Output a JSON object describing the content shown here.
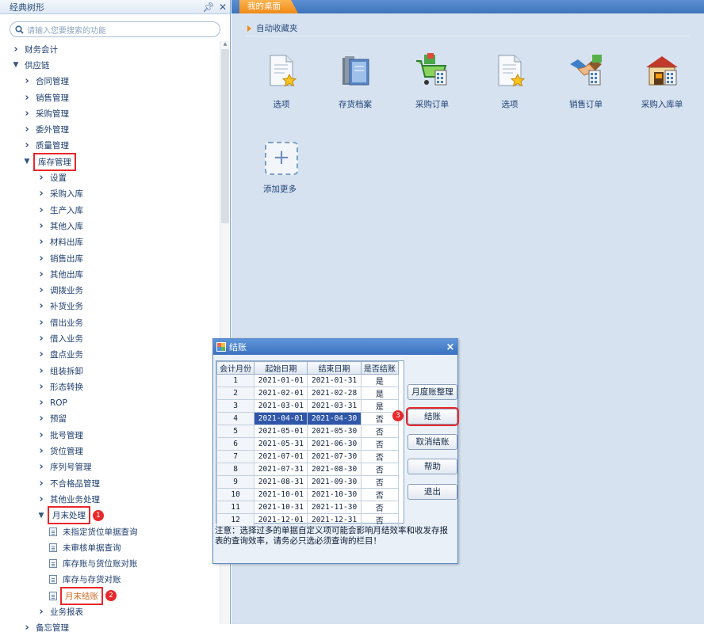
{
  "left_panel": {
    "title": "经典树形",
    "pin_icon": "pin-icon",
    "close_icon": "close-icon",
    "search_placeholder": "请输入您要搜索的功能",
    "tree": [
      {
        "label": "财务会计",
        "level": 0,
        "expanded": false
      },
      {
        "label": "供应链",
        "level": 0,
        "expanded": true
      },
      {
        "label": "合同管理",
        "level": 1,
        "expanded": false
      },
      {
        "label": "销售管理",
        "level": 1,
        "expanded": false
      },
      {
        "label": "采购管理",
        "level": 1,
        "expanded": false
      },
      {
        "label": "委外管理",
        "level": 1,
        "expanded": false
      },
      {
        "label": "质量管理",
        "level": 1,
        "expanded": false
      },
      {
        "label": "库存管理",
        "level": 1,
        "expanded": true,
        "highlight": true
      },
      {
        "label": "设置",
        "level": 2,
        "expanded": false
      },
      {
        "label": "采购入库",
        "level": 2,
        "expanded": false
      },
      {
        "label": "生产入库",
        "level": 2,
        "expanded": false
      },
      {
        "label": "其他入库",
        "level": 2,
        "expanded": false
      },
      {
        "label": "材料出库",
        "level": 2,
        "expanded": false
      },
      {
        "label": "销售出库",
        "level": 2,
        "expanded": false
      },
      {
        "label": "其他出库",
        "level": 2,
        "expanded": false
      },
      {
        "label": "调拨业务",
        "level": 2,
        "expanded": false
      },
      {
        "label": "补货业务",
        "level": 2,
        "expanded": false
      },
      {
        "label": "借出业务",
        "level": 2,
        "expanded": false
      },
      {
        "label": "借入业务",
        "level": 2,
        "expanded": false
      },
      {
        "label": "盘点业务",
        "level": 2,
        "expanded": false
      },
      {
        "label": "组装拆卸",
        "level": 2,
        "expanded": false
      },
      {
        "label": "形态转换",
        "level": 2,
        "expanded": false
      },
      {
        "label": "ROP",
        "level": 2,
        "expanded": false
      },
      {
        "label": "预留",
        "level": 2,
        "expanded": false
      },
      {
        "label": "批号管理",
        "level": 2,
        "expanded": false
      },
      {
        "label": "货位管理",
        "level": 2,
        "expanded": false
      },
      {
        "label": "序列号管理",
        "level": 2,
        "expanded": false
      },
      {
        "label": "不合格品管理",
        "level": 2,
        "expanded": false
      },
      {
        "label": "其他业务处理",
        "level": 2,
        "expanded": false
      },
      {
        "label": "月末处理",
        "level": 2,
        "expanded": true,
        "highlight": true,
        "badge": "1"
      },
      {
        "label": "未指定货位单据查询",
        "level": 3,
        "leaf": true
      },
      {
        "label": "未审核单据查询",
        "level": 3,
        "leaf": true
      },
      {
        "label": "库存账与货位账对账",
        "level": 3,
        "leaf": true
      },
      {
        "label": "库存与存货对账",
        "level": 3,
        "leaf": true
      },
      {
        "label": "月末结账",
        "level": 3,
        "leaf": true,
        "highlight": true,
        "badge": "2",
        "accent": "#d2691e"
      },
      {
        "label": "业务报表",
        "level": 2,
        "expanded": false
      },
      {
        "label": "备忘管理",
        "level": 1,
        "expanded": false
      }
    ]
  },
  "desktop": {
    "tab_label": "我的桌面",
    "favorites_title": "自动收藏夹",
    "shortcuts": [
      {
        "label": "选项",
        "icon": "document-star-icon"
      },
      {
        "label": "存货档案",
        "icon": "books-icon"
      },
      {
        "label": "采购订单",
        "icon": "shopping-cart-icon"
      },
      {
        "label": "选项",
        "icon": "document-star-icon"
      },
      {
        "label": "销售订单",
        "icon": "handshake-icon"
      },
      {
        "label": "采购入库单",
        "icon": "warehouse-icon"
      }
    ],
    "add_more_label": "添加更多",
    "add_icon": "plus-icon"
  },
  "dialog": {
    "title": "结账",
    "close": "×",
    "columns": [
      "会计月份",
      "起始日期",
      "结束日期",
      "是否结账"
    ],
    "rows": [
      [
        "1",
        "2021-01-01",
        "2021-01-31",
        "是"
      ],
      [
        "2",
        "2021-02-01",
        "2021-02-28",
        "是"
      ],
      [
        "3",
        "2021-03-01",
        "2021-03-31",
        "是"
      ],
      [
        "4",
        "2021-04-01",
        "2021-04-30",
        "否"
      ],
      [
        "5",
        "2021-05-01",
        "2021-05-30",
        "否"
      ],
      [
        "6",
        "2021-05-31",
        "2021-06-30",
        "否"
      ],
      [
        "7",
        "2021-07-01",
        "2021-07-30",
        "否"
      ],
      [
        "8",
        "2021-07-31",
        "2021-08-30",
        "否"
      ],
      [
        "9",
        "2021-08-31",
        "2021-09-30",
        "否"
      ],
      [
        "10",
        "2021-10-01",
        "2021-10-30",
        "否"
      ],
      [
        "11",
        "2021-10-31",
        "2021-11-30",
        "否"
      ],
      [
        "12",
        "2021-12-01",
        "2021-12-31",
        "否"
      ]
    ],
    "selected_row": 4,
    "buttons": {
      "reorg": "月度账整理",
      "close_account": "结账",
      "cancel_close": "取消结账",
      "help": "帮助",
      "exit": "退出"
    },
    "close_account_badge": "3",
    "note": "注意：选择过多的单据自定义项可能会影响月结效率和收发存报表的查询效率，请务必只选必须查询的栏目！"
  },
  "colors": {
    "accent": "#e8282b",
    "tab": "#f08a16",
    "selection": "#2f56a8"
  }
}
